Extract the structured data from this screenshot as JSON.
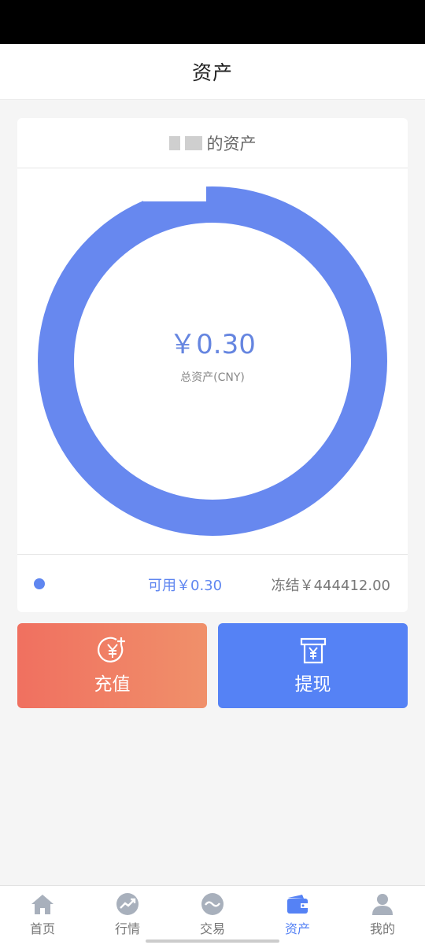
{
  "header": {
    "title": "资产"
  },
  "asset_card": {
    "title_suffix": "的资产",
    "total_amount": "￥0.30",
    "total_label": "总资产(CNY)",
    "available": "可用￥0.30",
    "frozen": "冻结￥444412.00",
    "accent_color": "#5f86f0"
  },
  "actions": {
    "recharge_label": "充值",
    "withdraw_label": "提现",
    "recharge_icon": "yen-plus-icon",
    "withdraw_icon": "yen-withdraw-icon"
  },
  "tabbar": {
    "items": [
      {
        "label": "首页",
        "icon": "home-icon"
      },
      {
        "label": "行情",
        "icon": "trend-icon"
      },
      {
        "label": "交易",
        "icon": "exchange-icon"
      },
      {
        "label": "资产",
        "icon": "wallet-icon",
        "active": true
      },
      {
        "label": "我的",
        "icon": "user-icon"
      }
    ]
  }
}
